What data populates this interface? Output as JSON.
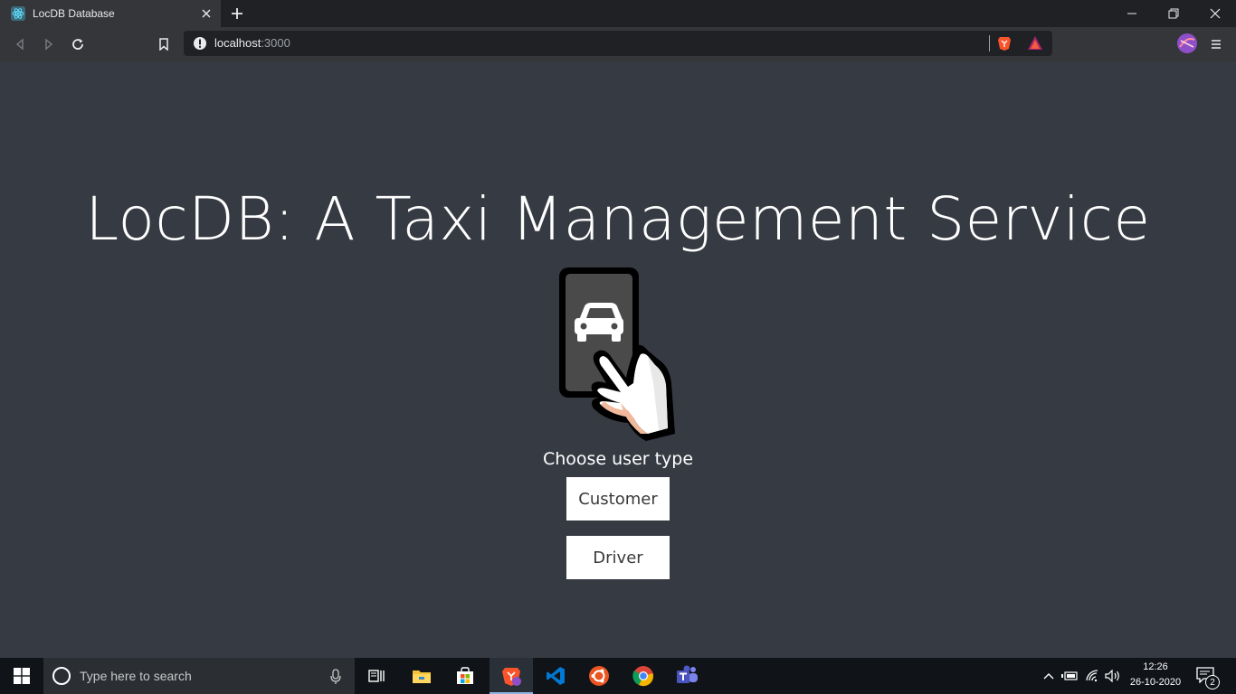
{
  "browser": {
    "tab_title": "LocDB Database",
    "url_host": "localhost",
    "url_port": ":3000"
  },
  "page": {
    "title": "LocDB: A Taxi Management Service",
    "prompt": "Choose user type",
    "buttons": {
      "customer": "Customer",
      "driver": "Driver"
    }
  },
  "taskbar": {
    "search_placeholder": "Type here to search",
    "time": "12:26",
    "date": "26-10-2020",
    "notification_count": "2",
    "apps": [
      "task-view",
      "file-explorer",
      "microsoft-store",
      "brave-browser",
      "vscode",
      "ubuntu",
      "chrome",
      "teams"
    ]
  },
  "colors": {
    "page_background": "#363a42",
    "button_background": "#ffffff",
    "chrome_dark": "#202124",
    "chrome_toolbar": "#35363a"
  }
}
